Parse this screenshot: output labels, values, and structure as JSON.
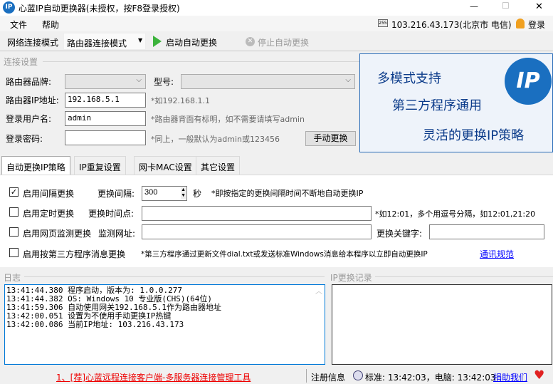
{
  "window": {
    "title": "心蓝IP自动更换器(未授权，按F8登录授权)",
    "minimize": "—",
    "maximize": "☐",
    "close": "✕"
  },
  "menu": {
    "file": "文件",
    "help": "帮助",
    "ip_status": "103.216.43.173(北京市 电信)",
    "login": "登录"
  },
  "toolbar": {
    "mode_label": "网络连接模式",
    "mode_value": "路由器连接模式",
    "start": "启动自动更换",
    "stop": "停止自动更换"
  },
  "connection": {
    "group": "连接设置",
    "brand_label": "路由器品牌:",
    "model_label": "型号:",
    "ip_label": "路由器IP地址:",
    "ip_value": "192.168.5.1",
    "ip_hint": "*如192.168.1.1",
    "user_label": "登录用户名:",
    "user_value": "admin",
    "user_hint": "*路由器背面有标明，如不需要请填写admin",
    "pwd_label": "登录密码:",
    "pwd_value": "",
    "pwd_hint": "*同上，一般默认为admin或123456",
    "manual_button": "手动更换"
  },
  "banner": {
    "line1": "多模式支持",
    "line2": "第三方程序通用",
    "line3": "灵活的更换IP策略",
    "logo": "IP"
  },
  "tabs": [
    "自动更换IP策略",
    "IP重复设置",
    "网卡MAC设置",
    "其它设置"
  ],
  "strategy": {
    "interval": {
      "label": "启用间隔更换",
      "checked": true,
      "field_label": "更换间隔:",
      "value": "300",
      "unit": "秒",
      "hint": "*即按指定的更换间隔时间不断地自动更换IP"
    },
    "timed": {
      "label": "启用定时更换",
      "checked": false,
      "field_label": "更换时间点:",
      "value": "",
      "hint": "*如12:01，多个用逗号分隔，如12:01,21:20"
    },
    "web": {
      "label": "启用网页监测更换",
      "checked": false,
      "field_label": "监测网址:",
      "value": "",
      "keyword_label": "更换关键字:",
      "keyword_value": ""
    },
    "third": {
      "label": "启用按第三方程序消息更换",
      "checked": false,
      "hint": "*第三方程序通过更新文件dial.txt或发送标准Windows消息给本程序以立即自动更换IP",
      "link": "通讯规范"
    }
  },
  "log": {
    "title": "日志",
    "lines": [
      "13:41:44.380 程序启动，版本为: 1.0.0.277",
      "13:41:44.382 OS: Windows 10 专业版(CHS)(64位)",
      "13:41:59.306 自动使用网关192.168.5.1作为路由器地址",
      "13:42:00.051 设置为不使用手动更换IP热键",
      "13:42:00.086 当前IP地址: 103.216.43.173"
    ]
  },
  "ip_history": {
    "title": "IP更换记录"
  },
  "status": {
    "promo": "1、[荐]心蓝远程连接客户端-多服务器连接管理工具",
    "register": "注册信息",
    "time": "标准: 13:42:03，电脑: 13:42:03",
    "donate": "捐助我们"
  }
}
